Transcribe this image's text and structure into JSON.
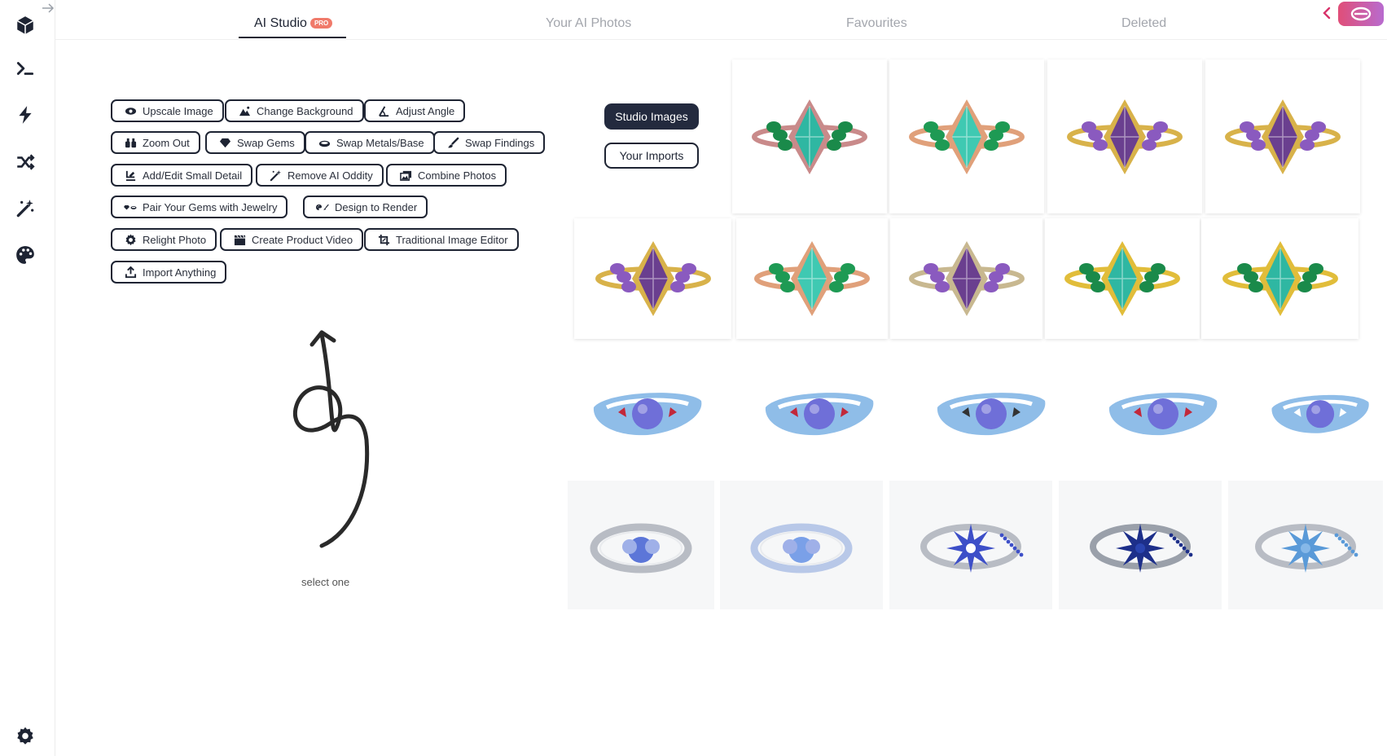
{
  "tabs": [
    {
      "label": "AI Studio",
      "badge": "PRO"
    },
    {
      "label": "Your AI Photos"
    },
    {
      "label": "Favourites"
    },
    {
      "label": "Deleted"
    }
  ],
  "sidebar": {
    "items": [
      "cube-icon",
      "terminal-icon",
      "bolt-icon",
      "shuffle-icon",
      "magic-wand-icon",
      "palette-icon"
    ],
    "footer": "gear-icon"
  },
  "tools": [
    {
      "label": "Upscale Image",
      "icon": "eye-icon"
    },
    {
      "label": "Change Background",
      "icon": "mountain-icon"
    },
    {
      "label": "Adjust Angle",
      "icon": "angle-icon"
    },
    {
      "label": "Zoom Out",
      "icon": "binoculars-icon"
    },
    {
      "label": "Swap Gems",
      "icon": "gem-icon"
    },
    {
      "label": "Swap Metals/Base",
      "icon": "ring-icon"
    },
    {
      "label": "Swap Findings",
      "icon": "brush-icon"
    },
    {
      "label": "Add/Edit Small Detail",
      "icon": "edit-detail-icon"
    },
    {
      "label": "Remove AI Oddity",
      "icon": "magic-wand-icon"
    },
    {
      "label": "Combine Photos",
      "icon": "images-icon"
    },
    {
      "label": "Pair Your Gems with Jewelry",
      "icon": "gem-ring-icon"
    },
    {
      "label": "Design to Render",
      "icon": "palette-brush-icon"
    },
    {
      "label": "Relight Photo",
      "icon": "sun-gear-icon"
    },
    {
      "label": "Create Product Video",
      "icon": "clapper-icon"
    },
    {
      "label": "Traditional Image Editor",
      "icon": "crop-icon"
    },
    {
      "label": "Import Anything",
      "icon": "upload-icon"
    }
  ],
  "hint": "select one",
  "sources": {
    "studio": "Studio Images",
    "imports": "Your Imports"
  },
  "colors": {
    "accent": "#232a3e",
    "badge": "#f07a6a",
    "profile_gradient": [
      "#e04e78",
      "#b86bcf"
    ]
  },
  "gallery": [
    {
      "subject": "marquise-ring",
      "gem": "#2fb7a2",
      "accent": "#1a8a4a",
      "metal": "#c98a8a"
    },
    {
      "subject": "marquise-ring",
      "gem": "#3fc9b2",
      "accent": "#1e9a54",
      "metal": "#e0a07a"
    },
    {
      "subject": "marquise-ring",
      "gem": "#6a3f8f",
      "accent": "#8a5abf",
      "metal": "#d8b24a"
    },
    {
      "subject": "marquise-ring",
      "gem": "#6a3f8f",
      "accent": "#8a5abf",
      "metal": "#d8b24a"
    },
    {
      "subject": "marquise-ring",
      "gem": "#6a3f8f",
      "accent": "#8a5abf",
      "metal": "#d8b24a"
    },
    {
      "subject": "marquise-ring",
      "gem": "#3fc9b2",
      "accent": "#1e9a54",
      "metal": "#e0a07a"
    },
    {
      "subject": "marquise-ring",
      "gem": "#6a3f8f",
      "accent": "#8a5abf",
      "metal": "#c8b890"
    },
    {
      "subject": "marquise-ring",
      "gem": "#2fb7a2",
      "accent": "#1a8a4a",
      "metal": "#e1bd3a"
    },
    {
      "subject": "marquise-ring",
      "gem": "#2fb7a2",
      "accent": "#1a8a4a",
      "metal": "#e1bd3a"
    },
    {
      "subject": "enamel-ring",
      "gem": "#6f6fd8",
      "accent": "#c2283a",
      "metal": "#8fbde8"
    },
    {
      "subject": "enamel-ring",
      "gem": "#6f6fd8",
      "accent": "#c2283a",
      "metal": "#8fbde8"
    },
    {
      "subject": "enamel-ring",
      "gem": "#6f6fd8",
      "accent": "#333333",
      "metal": "#8fbde8"
    },
    {
      "subject": "enamel-ring",
      "gem": "#6f6fd8",
      "accent": "#c2283a",
      "metal": "#8fbde8"
    },
    {
      "subject": "enamel-ring",
      "gem": "#6f6fd8",
      "accent": "#ffffff",
      "metal": "#8fbde8"
    },
    {
      "subject": "silver-ring",
      "gem": "#5c76d8",
      "accent": "#9fb0e8",
      "metal": "#b8bcc4"
    },
    {
      "subject": "silver-ring",
      "gem": "#7aa0e8",
      "accent": "#9fb0e8",
      "metal": "#b8c8e8"
    },
    {
      "subject": "star-ring",
      "gem": "#3d4fc8",
      "accent": "#ffffff",
      "metal": "#b8bcc4"
    },
    {
      "subject": "star-ring",
      "gem": "#1d2f8a",
      "accent": "#2a44b0",
      "metal": "#9aa0aa"
    },
    {
      "subject": "star-ring",
      "gem": "#5a9ad8",
      "accent": "#86b8e8",
      "metal": "#b8bcc4"
    }
  ]
}
